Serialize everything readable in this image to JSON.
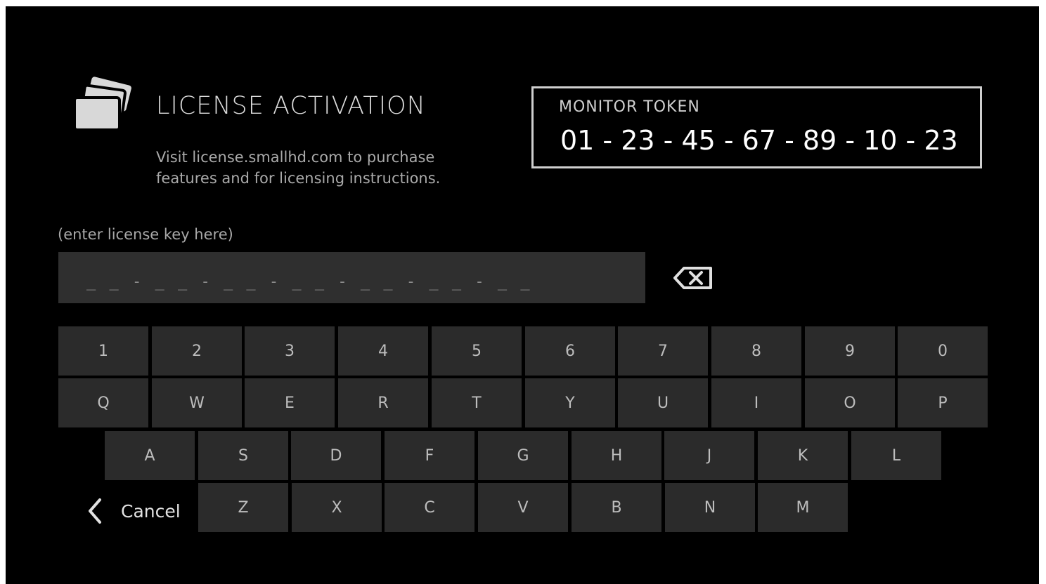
{
  "header": {
    "title": "LICENSE ACTIVATION",
    "instructions_line1": "Visit license.smallhd.com to purchase",
    "instructions_line2": "features and for licensing instructions."
  },
  "token": {
    "label": "MONITOR TOKEN",
    "value": "01 - 23 - 45 - 67 - 89 - 10 - 23"
  },
  "license_input": {
    "hint": "(enter license key here)",
    "mask": "_ _ - _ _ - _ _ - _ _ - _ _ - _ _ - _ _"
  },
  "keyboard": {
    "rows": [
      [
        "1",
        "2",
        "3",
        "4",
        "5",
        "6",
        "7",
        "8",
        "9",
        "0"
      ],
      [
        "Q",
        "W",
        "E",
        "R",
        "T",
        "Y",
        "U",
        "I",
        "O",
        "P"
      ],
      [
        "A",
        "S",
        "D",
        "F",
        "G",
        "H",
        "J",
        "K",
        "L"
      ],
      [
        "Z",
        "X",
        "C",
        "V",
        "B",
        "N",
        "M"
      ]
    ],
    "cancel_label": "Cancel"
  },
  "icons": {
    "license": "license-cards-icon",
    "backspace": "backspace-icon",
    "cancel": "chevron-left-icon"
  },
  "colors": {
    "background": "#000000",
    "key": "#2b2b2b",
    "text": "#d6d6d6"
  }
}
